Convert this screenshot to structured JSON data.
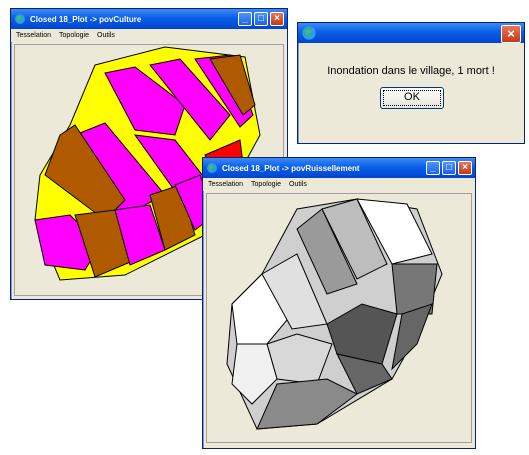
{
  "window1": {
    "title": "Closed 18_Plot -> povCulture",
    "menu": [
      "Tesselation",
      "Topologie",
      "Outils"
    ],
    "palette": {
      "yellow": "#ffff00",
      "magenta": "#ff00ff",
      "brown": "#b05a00",
      "red": "#ff0000",
      "background": "#ece9d8"
    }
  },
  "dialog": {
    "message": "Inondation dans le village, 1 mort !",
    "ok_label": "OK"
  },
  "window2": {
    "title": "Closed 18_Plot -> povRuissellement",
    "menu": [
      "Tesselation",
      "Topologie",
      "Outils"
    ],
    "palette": {
      "white": "#ffffff",
      "light_gray": "#cfcfcf",
      "mid_gray": "#9a9a9a",
      "dark_gray": "#555555",
      "background": "#ece9d8"
    }
  },
  "icons": {
    "app": "globe-icon",
    "minimize": "minimize-icon",
    "maximize": "maximize-icon",
    "close": "close-icon"
  }
}
